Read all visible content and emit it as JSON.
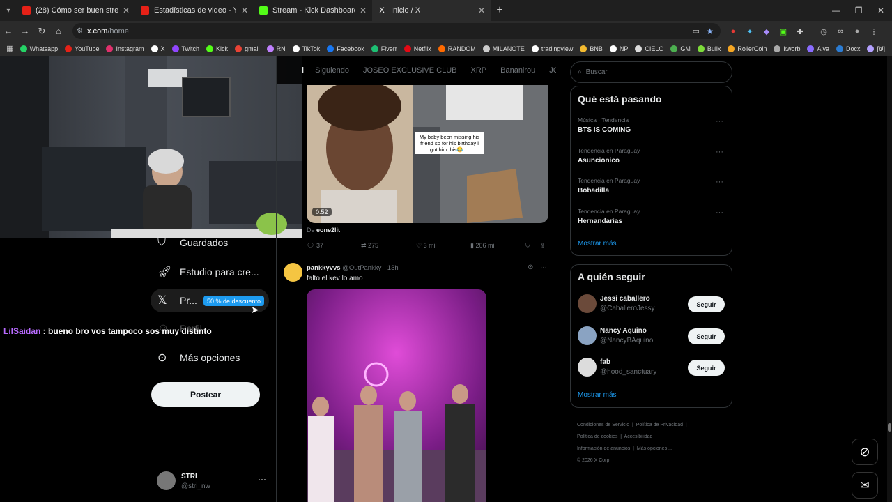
{
  "browser": {
    "tabs": [
      {
        "title": "(28) Cómo ser buen streamer e",
        "favicon_color": "#e62117",
        "active": false
      },
      {
        "title": "Estadísticas de video - YouTube",
        "favicon_color": "#e62117",
        "active": false
      },
      {
        "title": "Stream - Kick Dashboard",
        "favicon_color": "#53fc18",
        "active": false
      },
      {
        "title": "Inicio / X",
        "favicon_color": "#ffffff",
        "active": true
      }
    ],
    "url_host": "x.com",
    "url_path": "/home",
    "bookmarks": [
      {
        "label": "Whatsapp",
        "color": "#25d366"
      },
      {
        "label": "YouTube",
        "color": "#e62117"
      },
      {
        "label": "Instagram",
        "color": "#e1306c"
      },
      {
        "label": "X",
        "color": "#ffffff"
      },
      {
        "label": "Twitch",
        "color": "#9146ff"
      },
      {
        "label": "Kick",
        "color": "#53fc18"
      },
      {
        "label": "gmail",
        "color": "#ea4335"
      },
      {
        "label": "RN",
        "color": "#c080ff"
      },
      {
        "label": "TikTok",
        "color": "#ffffff"
      },
      {
        "label": "Facebook",
        "color": "#1877f2"
      },
      {
        "label": "Fiverr",
        "color": "#1dbf73"
      },
      {
        "label": "Netflix",
        "color": "#e50914"
      },
      {
        "label": "RANDOM",
        "color": "#ff6a00"
      },
      {
        "label": "MILANOTE",
        "color": "#cccccc"
      },
      {
        "label": "tradingview",
        "color": "#ffffff"
      },
      {
        "label": "BNB",
        "color": "#f3ba2f"
      },
      {
        "label": "NP",
        "color": "#ffffff"
      },
      {
        "label": "CIELO",
        "color": "#dddddd"
      },
      {
        "label": "GM",
        "color": "#4caf50"
      },
      {
        "label": "Bullx",
        "color": "#7ddc3a"
      },
      {
        "label": "RollerCoin",
        "color": "#f5a623"
      },
      {
        "label": "kworb",
        "color": "#aaaaaa"
      },
      {
        "label": "Alva",
        "color": "#8a6cff"
      },
      {
        "label": "Docx",
        "color": "#2b7cd3"
      },
      {
        "label": "[U]",
        "color": "#b3a0ff"
      }
    ]
  },
  "sidebar": {
    "items": [
      {
        "label": "Guardados",
        "icon": "bookmark-icon"
      },
      {
        "label": "Estudio para cre...",
        "icon": "rocket-icon"
      },
      {
        "label": "Pr...",
        "icon": "x-logo-icon",
        "badge": "50 % de descuento"
      },
      {
        "label": "Perfil",
        "icon": "person-icon"
      },
      {
        "label": "Más opciones",
        "icon": "more-circle-icon"
      }
    ],
    "post_button": "Postear",
    "account": {
      "name": "STRI",
      "handle": "@stri_nw"
    }
  },
  "overlay": {
    "chat_user": "LilSaidan",
    "chat_message": " : bueno bro vos tampoco sos muy distinto"
  },
  "feed": {
    "tabs": [
      "Siguiendo",
      "JOSEO EXCLUSIVE CLUB",
      "XRP",
      "Bananirou",
      "JOS"
    ],
    "post1": {
      "video_caption": "My baby been missing his friend so for his birthday i got him this😂....",
      "duration": "0:52",
      "from_prefix": "De ",
      "from_user": "eone2lit",
      "replies": "37",
      "reposts": "275",
      "likes": "3 mil",
      "views": "206 mil"
    },
    "post2": {
      "name": "pankkyvvs",
      "handle": "@OutPankky",
      "time": "· 13h",
      "text": "falto el kev lo amo"
    }
  },
  "right": {
    "search_placeholder": "Buscar",
    "trends_title": "Qué está pasando",
    "trends": [
      {
        "context": "Música · Tendencia",
        "name": "BTS IS COMING"
      },
      {
        "context": "Tendencia en Paraguay",
        "name": "Asuncionico"
      },
      {
        "context": "Tendencia en Paraguay",
        "name": "Bobadilla"
      },
      {
        "context": "Tendencia en Paraguay",
        "name": "Hernandarias"
      }
    ],
    "show_more": "Mostrar más",
    "follow_title": "A quién seguir",
    "follow": [
      {
        "name": "Jessi caballero",
        "handle": "@CaballeroJessy",
        "button": "Seguir"
      },
      {
        "name": "Nancy Aquino",
        "handle": "@NancyBAquino",
        "button": "Seguir"
      },
      {
        "name": "fab",
        "handle": "@hood_sanctuary",
        "button": "Seguir"
      }
    ],
    "show_more2": "Mostrar más",
    "footer": {
      "l1": "Condiciones de Servicio",
      "l2": "Política de Privacidad",
      "l3": "Política de cookies",
      "l4": "Accesibilidad",
      "l5": "Información de anuncios",
      "l6": "Más opciones ...",
      "copyright": "© 2026 X Corp."
    }
  }
}
